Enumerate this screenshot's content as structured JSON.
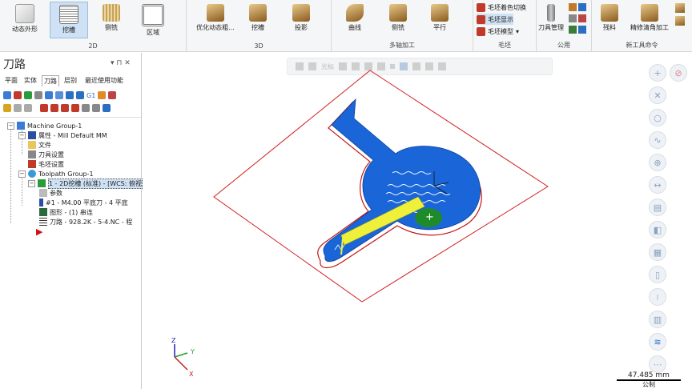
{
  "ribbon": {
    "groups": {
      "g2d": "2D",
      "g3d": "3D",
      "multiaxis": "多轴加工",
      "stock": "毛坯",
      "common": "公用",
      "newtools": "新工具命令"
    },
    "buttons": {
      "dynamic_contour": "动态外形",
      "pocket": "挖槽",
      "side_mill": "铡铣",
      "area": "区域",
      "opt_dynamic_rough": "优化动态粗...",
      "pocket3d": "挖槽",
      "projection": "投影",
      "curve": "曲线",
      "side_mill_ma": "侧铣",
      "parallel": "平行",
      "stock_shade_toggle": "毛坯着色切换",
      "stock_display": "毛坯显示",
      "stock_model": "毛坯模型",
      "tool_manager": "刀具管理",
      "residual": "残料",
      "fine_corner": "精修清角加工"
    }
  },
  "panel": {
    "title": "刀路",
    "pin": "▾ ⊓ ✕",
    "tabs": [
      "平面",
      "实体",
      "刀路",
      "层别",
      "最近使用功能"
    ],
    "tree": {
      "machine_group": "Machine Group-1",
      "properties": "属性 - Mill Default MM",
      "files": "文件",
      "tool_settings": "刀具设置",
      "stock_settings": "毛坯设置",
      "toolpath_group": "Toolpath Group-1",
      "op1": "1 - 2D挖槽 (标准) - [WCS: 俯视",
      "params": "参数",
      "tool": "#1 - M4.00 平底刀 - 4 平底",
      "geometry": "图形 - (1) 串连",
      "toolpath": "刀路 - 928.2K - 5-4.NC - 程"
    }
  },
  "viewport": {
    "topbar": {
      "cursor_label": "光标"
    },
    "scale": {
      "value": "47.485 mm",
      "unit": "公制"
    },
    "triad": {
      "x": "X",
      "y": "Y",
      "z": "Z"
    }
  },
  "colors": {
    "part": "#1a66d8",
    "stock_outline": "#d42020",
    "tool_path": "#eef03a",
    "tool": "#1f8a2a",
    "accent": "#cfe1f4"
  }
}
